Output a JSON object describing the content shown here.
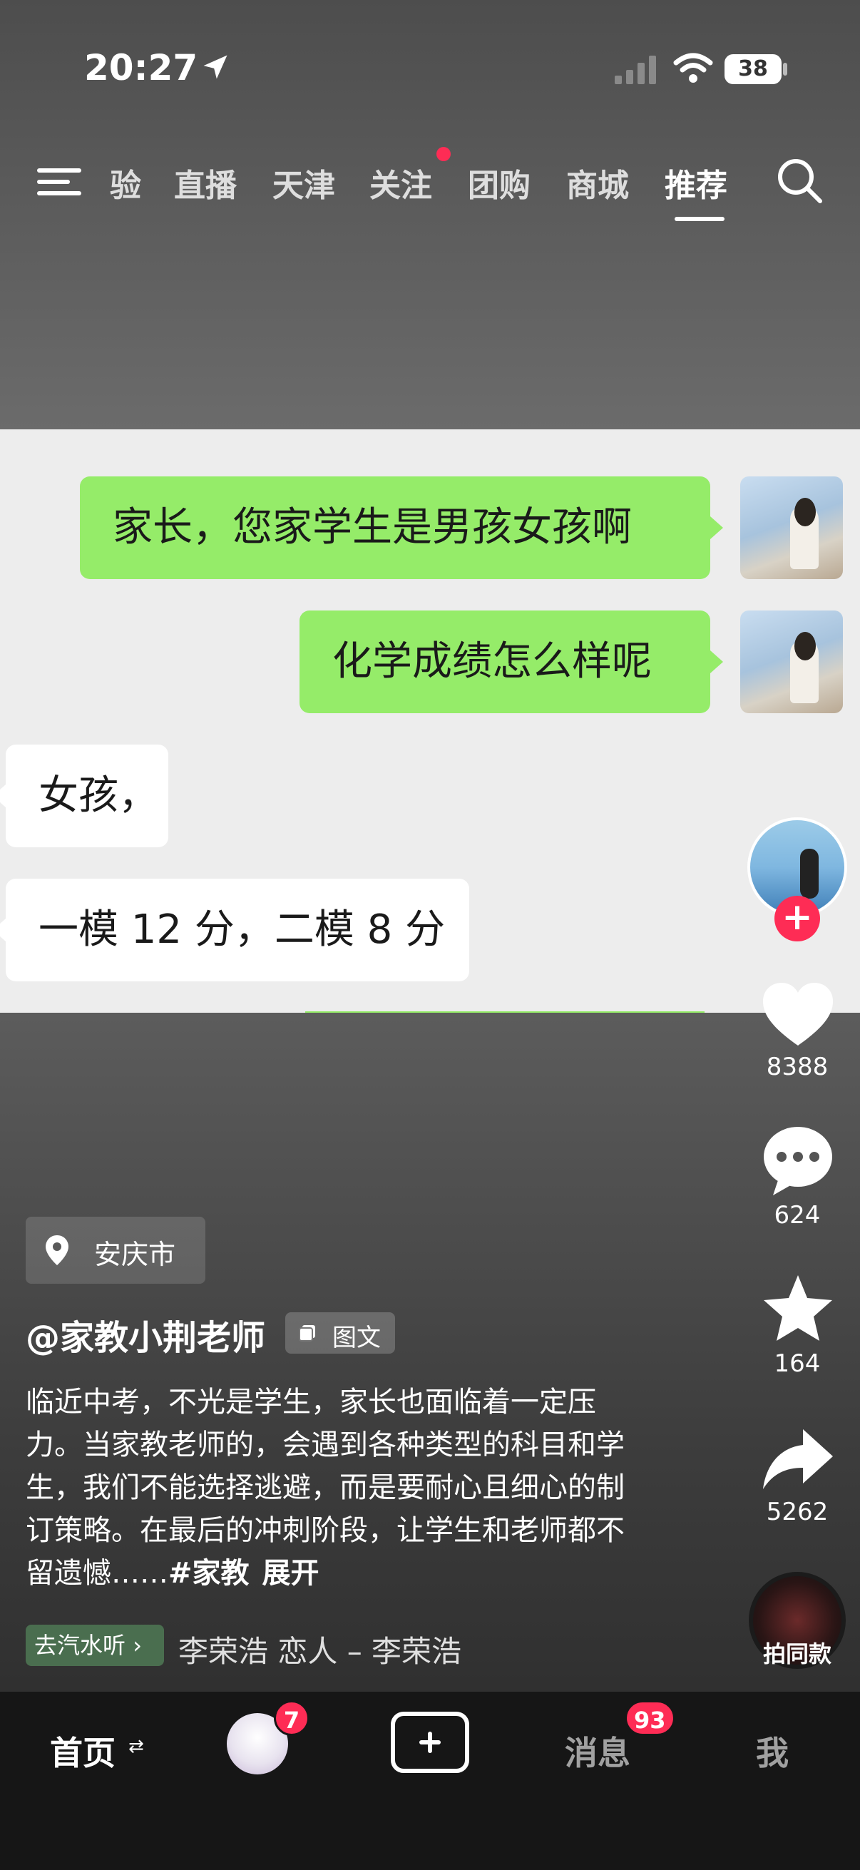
{
  "status_bar": {
    "time": "20:27",
    "battery": "38"
  },
  "top_nav": {
    "tabs": [
      "验",
      "直播",
      "天津",
      "关注",
      "团购",
      "商城",
      "推荐"
    ],
    "active_tab": "推荐"
  },
  "chat": {
    "messages": [
      {
        "side": "right",
        "text": "家长，您家学生是男孩女孩啊"
      },
      {
        "side": "right",
        "text": "化学成绩怎么样呢"
      },
      {
        "side": "left",
        "text": "女孩，"
      },
      {
        "side": "left",
        "text": "一模 12 分，二模 8 分"
      }
    ]
  },
  "sidebar": {
    "likes": "8388",
    "comments": "624",
    "favorites": "164",
    "shares": "5262",
    "same_style": "拍同款"
  },
  "post": {
    "location": "安庆市",
    "author": "@家教小荆老师",
    "type_label": "图文",
    "description": "临近中考，不光是学生，家长也面临着一定压力。当家教老师的，会遇到各种类型的科目和学生，我们不能选择逃避，而是要耐心且细心的制订策略。在最后的冲刺阶段，让学生和老师都不留遗憾……",
    "hashtag": "#家教",
    "expand": "展开",
    "music_chip": "去汽水听",
    "music_text": "李荣浩    恋人 – 李荣浩"
  },
  "tab_bar": {
    "home": "首页",
    "friends_badge": "7",
    "messages": "消息",
    "messages_badge": "93",
    "me": "我"
  },
  "colors": {
    "accent_red": "#fe2c55",
    "chat_green": "#95ec69",
    "chat_bg": "#ededed"
  }
}
